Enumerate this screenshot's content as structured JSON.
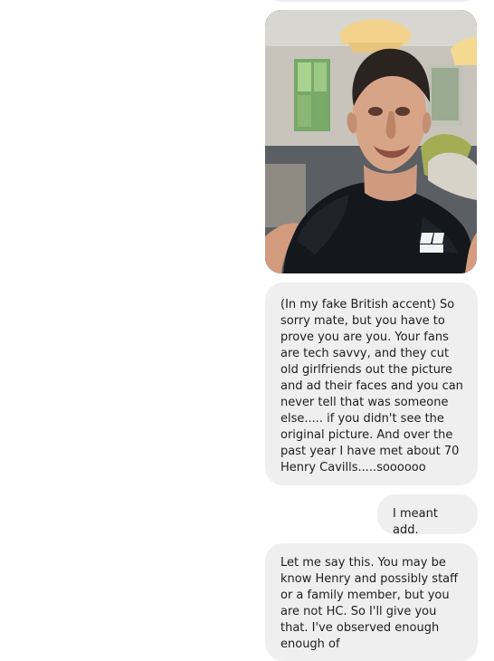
{
  "conversation": {
    "messages": [
      {
        "type": "image",
        "content_icon": "person-photo"
      },
      {
        "type": "text",
        "text": "(In my fake British accent) So sorry mate, but you have to prove you are you. Your fans are tech savvy, and they cut old girlfriends out the picture and ad their faces and you can never tell that was someone else..... if you didn't see the original picture. And over the past year I have met about 70 Henry Cavills.....soooooo"
      },
      {
        "type": "text",
        "text": "I meant add."
      },
      {
        "type": "text",
        "text": "Let me say this. You may be know Henry and possibly staff or a family member, but you are not HC. So I'll give you that. I've observed enough enough of"
      }
    ]
  },
  "colors": {
    "bubble_background": "#efefef",
    "text": "#202020",
    "page_background": "#ffffff"
  }
}
